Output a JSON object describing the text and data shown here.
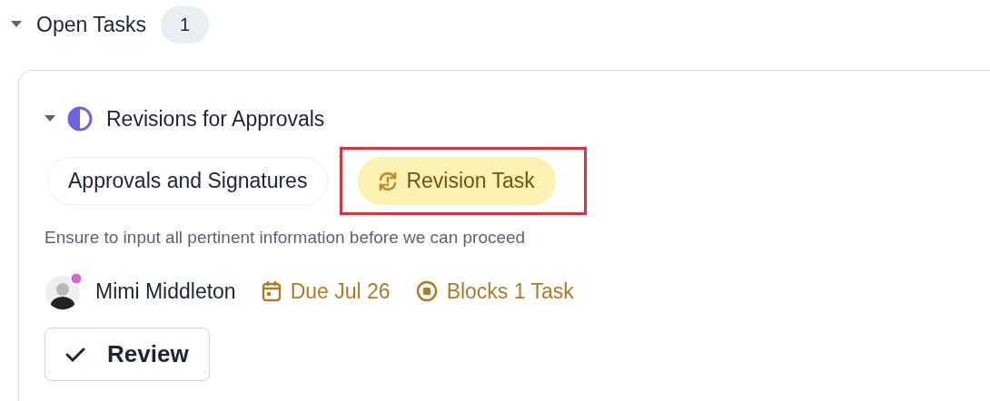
{
  "section": {
    "title": "Open Tasks",
    "count": "1",
    "expanded": true
  },
  "task": {
    "title": "Revisions for Approvals",
    "expanded": true,
    "tags": [
      {
        "label": "Approvals and Signatures",
        "kind": "plain",
        "highlighted": false
      },
      {
        "label": "Revision Task",
        "kind": "revision",
        "highlighted": true
      }
    ],
    "description": "Ensure to input all pertinent information before we can proceed",
    "assignee": "Mimi Middleton",
    "due": "Due Jul 26",
    "blocks": "Blocks 1 Task",
    "action": "Review"
  }
}
